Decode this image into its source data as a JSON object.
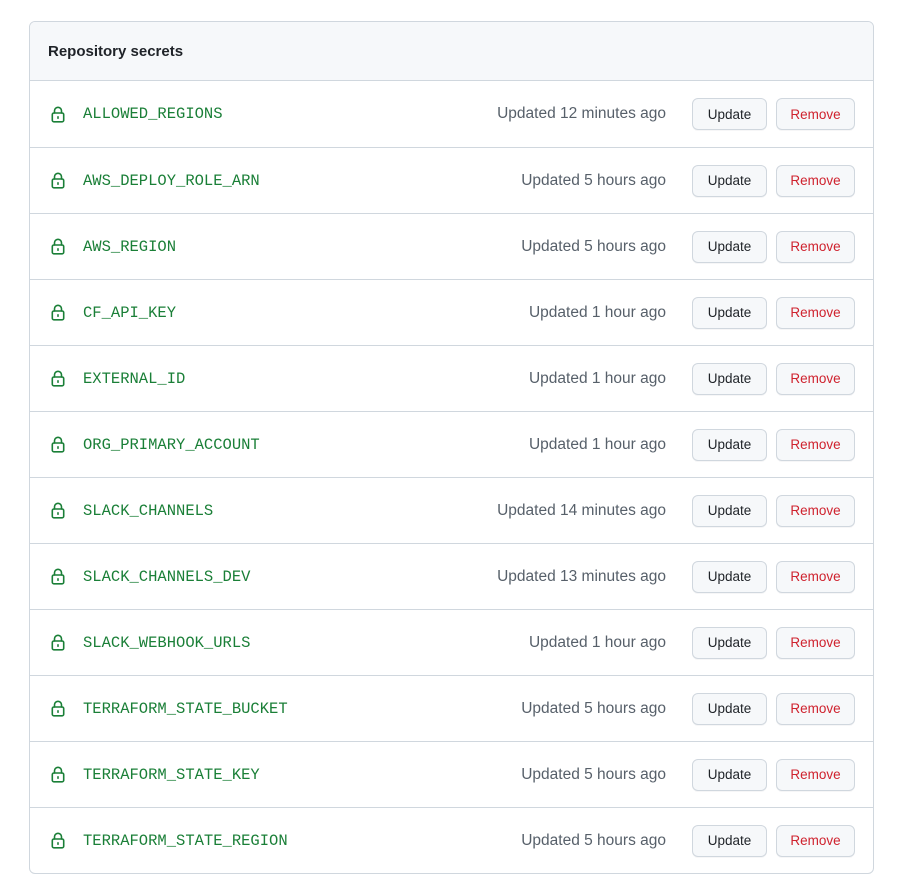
{
  "panel": {
    "title": "Repository secrets"
  },
  "colors": {
    "secret_name": "#1a7f37",
    "remove_text": "#cf222e",
    "header_bg": "#f6f8fa",
    "border": "#d0d7de"
  },
  "icons": {
    "row_icon": "lock-icon"
  },
  "actions": {
    "update_label": "Update",
    "remove_label": "Remove"
  },
  "secrets": [
    {
      "name": "ALLOWED_REGIONS",
      "updated": "Updated 12 minutes ago"
    },
    {
      "name": "AWS_DEPLOY_ROLE_ARN",
      "updated": "Updated 5 hours ago"
    },
    {
      "name": "AWS_REGION",
      "updated": "Updated 5 hours ago"
    },
    {
      "name": "CF_API_KEY",
      "updated": "Updated 1 hour ago"
    },
    {
      "name": "EXTERNAL_ID",
      "updated": "Updated 1 hour ago"
    },
    {
      "name": "ORG_PRIMARY_ACCOUNT",
      "updated": "Updated 1 hour ago"
    },
    {
      "name": "SLACK_CHANNELS",
      "updated": "Updated 14 minutes ago"
    },
    {
      "name": "SLACK_CHANNELS_DEV",
      "updated": "Updated 13 minutes ago"
    },
    {
      "name": "SLACK_WEBHOOK_URLS",
      "updated": "Updated 1 hour ago"
    },
    {
      "name": "TERRAFORM_STATE_BUCKET",
      "updated": "Updated 5 hours ago"
    },
    {
      "name": "TERRAFORM_STATE_KEY",
      "updated": "Updated 5 hours ago"
    },
    {
      "name": "TERRAFORM_STATE_REGION",
      "updated": "Updated 5 hours ago"
    }
  ]
}
